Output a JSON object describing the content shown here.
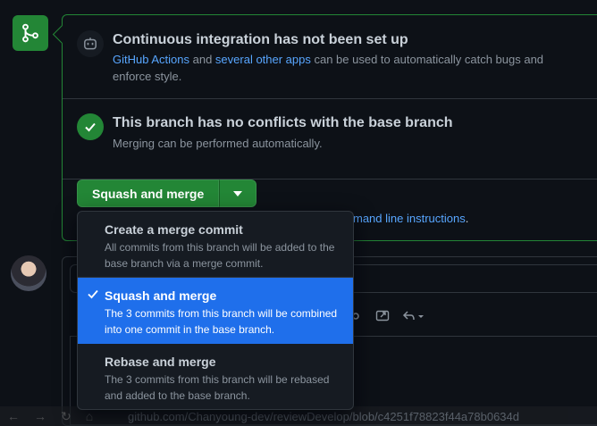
{
  "ci": {
    "title": "Continuous integration has not been set up",
    "link1": "GitHub Actions",
    "text_and": " and ",
    "link2": "several other apps",
    "text_rest": " can be used to automatically catch bugs and enforce style."
  },
  "conflicts": {
    "title": "This branch has no conflicts with the base branch",
    "desc": "Merging can be performed automatically."
  },
  "merge_button": {
    "label": "Squash and merge"
  },
  "cmd_line": {
    "link": "mand line instructions",
    "suffix": "."
  },
  "dropdown": {
    "items": [
      {
        "title": "Create a merge commit",
        "desc": "All commits from this branch will be added to the base branch via a merge commit.",
        "selected": false
      },
      {
        "title": "Squash and merge",
        "desc": "The 3 commits from this branch will be combined into one commit in the base branch.",
        "selected": true
      },
      {
        "title": "Rebase and merge",
        "desc": "The 3 commits from this branch will be rebased and added to the base branch.",
        "selected": false
      }
    ]
  },
  "browser": {
    "url": "github.com/Chanyoung-dev/reviewDevelop/blob/c4251f78823f44a78b0634d"
  },
  "colors": {
    "accent_green": "#238636",
    "link_blue": "#58a6ff",
    "selected_blue": "#1f6feb"
  }
}
